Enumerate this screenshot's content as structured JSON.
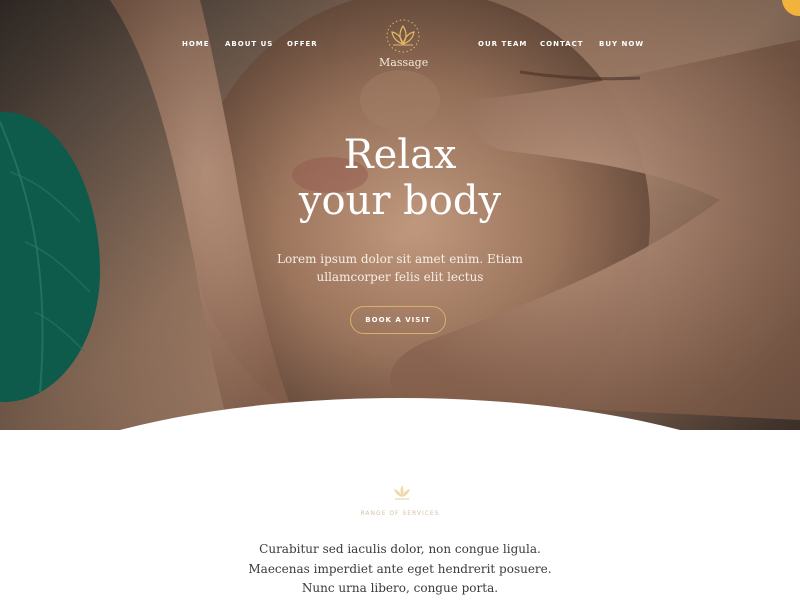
{
  "nav": {
    "left": [
      "HOME",
      "ABOUT US",
      "OFFER"
    ],
    "right": [
      "OUR TEAM",
      "CONTACT",
      "BUY NOW"
    ]
  },
  "logo": {
    "brand": "Massage",
    "icon": "lotus-icon"
  },
  "hero": {
    "headline_line1": "Relax",
    "headline_line2": "your body",
    "subtitle_line1": "Lorem ipsum dolor sit amet enim. Etiam",
    "subtitle_line2": "ullamcorper felis elit lectus",
    "cta_label": "BOOK A VISIT"
  },
  "services": {
    "icon": "lotus-icon",
    "label": "RANGE OF SERVICES",
    "lines": [
      "Curabitur sed iaculis dolor, non congue ligula.",
      "Maecenas imperdiet ante eget hendrerit posuere.",
      "Nunc urna libero, congue porta."
    ]
  },
  "colors": {
    "accent_gold": "#d9b06a",
    "leaf_green": "#0e5a4b",
    "corner_yellow": "#f2b33d"
  }
}
